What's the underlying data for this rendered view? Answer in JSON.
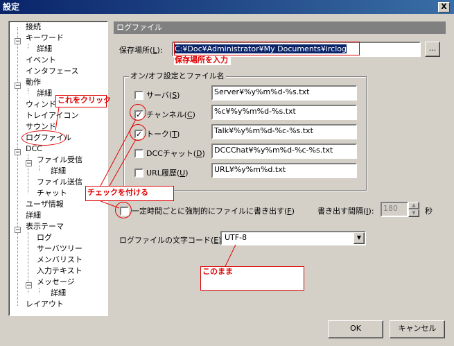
{
  "window": {
    "title": "設定",
    "close_glyph": "X"
  },
  "tree": {
    "items": [
      {
        "label": "接続",
        "level": 1
      },
      {
        "label": "キーワード",
        "level": 1
      },
      {
        "label": "詳細",
        "level": 2
      },
      {
        "label": "イベント",
        "level": 1
      },
      {
        "label": "インタフェース",
        "level": 1
      },
      {
        "label": "動作",
        "level": 1
      },
      {
        "label": "詳細",
        "level": 2
      },
      {
        "label": "ウィンドウ",
        "level": 1
      },
      {
        "label": "トレイアイコン",
        "level": 1
      },
      {
        "label": "サウンド",
        "level": 1
      },
      {
        "label": "ログファイル",
        "level": 1
      },
      {
        "label": "DCC",
        "level": 1
      },
      {
        "label": "ファイル受信",
        "level": 2
      },
      {
        "label": "詳細",
        "level": 3
      },
      {
        "label": "ファイル送信",
        "level": 2
      },
      {
        "label": "チャット",
        "level": 2
      },
      {
        "label": "ユーザ情報",
        "level": 1
      },
      {
        "label": "詳細",
        "level": 1
      },
      {
        "label": "表示テーマ",
        "level": 1
      },
      {
        "label": "ログ",
        "level": 2
      },
      {
        "label": "サーバツリー",
        "level": 2
      },
      {
        "label": "メンバリスト",
        "level": 2
      },
      {
        "label": "入力テキスト",
        "level": 2
      },
      {
        "label": "メッセージ",
        "level": 2
      },
      {
        "label": "詳細",
        "level": 3
      },
      {
        "label": "レイアウト",
        "level": 1
      }
    ]
  },
  "panel": {
    "title": "ログファイル",
    "save_location": {
      "label": "保存場所(",
      "key": "L",
      "label_end": "):",
      "value": "C:¥Doc¥Administrator¥My Documents¥irclog",
      "browse_label": "..."
    },
    "onoff_group": {
      "title": "オン/オフ設定とファイル名"
    },
    "rows": [
      {
        "label": "サーバ(",
        "key": "S",
        "end": ")",
        "checked": false,
        "value": "Server¥%y%m%d-%s.txt"
      },
      {
        "label": "チャンネル(",
        "key": "C",
        "end": ")",
        "checked": true,
        "value": "%c¥%y%m%d-%s.txt"
      },
      {
        "label": "トーク(",
        "key": "T",
        "end": ")",
        "checked": true,
        "value": "Talk¥%y%m%d-%c-%s.txt"
      },
      {
        "label": "DCCチャット(",
        "key": "D",
        "end": ")",
        "checked": false,
        "value": "DCCChat¥%y%m%d-%c-%s.txt"
      },
      {
        "label": "URL履歴(",
        "key": "U",
        "end": ")",
        "checked": false,
        "value": "URL¥%y%m%d.txt"
      }
    ],
    "force_write": {
      "label": "一定時間ごとに強制的にファイルに書き出す(",
      "key": "F",
      "end": ")",
      "checked": false
    },
    "interval": {
      "label": "書き出す間隔(",
      "key": "I",
      "end": "):",
      "value": "180",
      "unit": "秒"
    },
    "encoding": {
      "label": "ログファイルの文字コード(",
      "key": "E",
      "end": "):",
      "value": "UTF-8"
    }
  },
  "buttons": {
    "ok": "OK",
    "cancel": "キャンセル"
  },
  "annotations": {
    "save_location": "保存場所を入力",
    "click_this": "これをクリック",
    "check_these": "チェックを付ける",
    "keep_as_is": "このまま"
  },
  "colors": {
    "annotation": "#e00000",
    "selection": "#0a246a",
    "face": "#d4d0c8"
  }
}
